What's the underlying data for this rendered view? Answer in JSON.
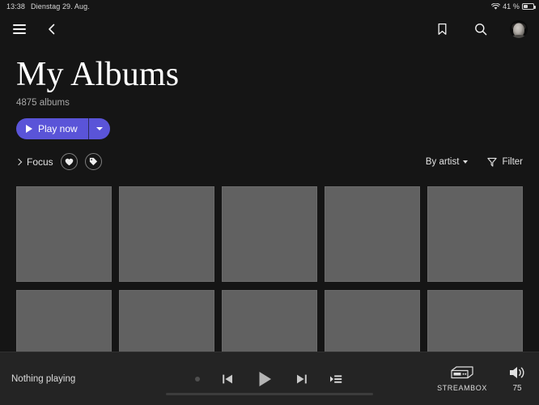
{
  "statusbar": {
    "time": "13:38",
    "date": "Dienstag 29. Aug.",
    "wifi_icon": "wifi-icon",
    "battery_percent": "41 %",
    "battery_icon": "battery-icon"
  },
  "topbar": {
    "menu_icon": "hamburger-menu-icon",
    "back_icon": "back-chevron-icon",
    "bookmark_icon": "bookmark-icon",
    "search_icon": "search-icon",
    "avatar": "user-avatar"
  },
  "header": {
    "title": "My Albums",
    "subtitle": "4875 albums"
  },
  "actions": {
    "play_label": "Play now",
    "play_icon": "play-triangle-icon",
    "more_icon": "chevron-down-icon"
  },
  "filterbar": {
    "focus_label": "Focus",
    "focus_chevron": "chevron-right-icon",
    "favorite_icon": "heart-icon",
    "tag_icon": "tag-icon",
    "sort_label": "By artist",
    "sort_caret": "chevron-down-icon",
    "filter_label": "Filter",
    "filter_icon": "funnel-icon"
  },
  "grid": {
    "tiles": [
      {
        "id": "album-1"
      },
      {
        "id": "album-2"
      },
      {
        "id": "album-3"
      },
      {
        "id": "album-4"
      },
      {
        "id": "album-5"
      },
      {
        "id": "album-6"
      },
      {
        "id": "album-7"
      },
      {
        "id": "album-8"
      },
      {
        "id": "album-9"
      },
      {
        "id": "album-10"
      }
    ]
  },
  "player": {
    "now_playing": "Nothing playing",
    "shuffle_icon": "shuffle-dot-icon",
    "previous_icon": "previous-track-icon",
    "play_icon": "play-icon",
    "next_icon": "next-track-icon",
    "queue_icon": "play-queue-icon",
    "device_icon": "streaming-device-icon",
    "device_label": "STREAMBOX",
    "volume_icon": "speaker-volume-icon",
    "volume_value": "75"
  },
  "colors": {
    "background": "#151515",
    "accent": "#5a54d8",
    "player_bg": "#242424",
    "tile": "#616161"
  }
}
